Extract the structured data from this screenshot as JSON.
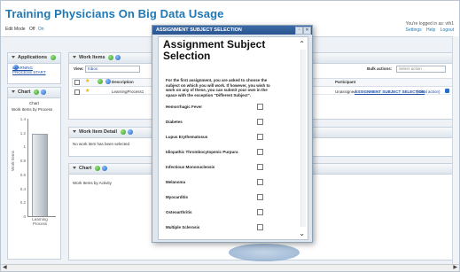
{
  "header": {
    "title": "Training Physicians On Big Data Usage",
    "edit_mode_label": "Edit Mode",
    "edit_off": "Off",
    "edit_on": "On",
    "logged_in": "You're logged in as: vth1",
    "settings": "Settings",
    "help": "Help",
    "logout": "Logout"
  },
  "applications": {
    "title": "Applications",
    "link": "LEARNING PROCESS START"
  },
  "chart_panel": {
    "title": "Chart",
    "subtitle": "Chart",
    "caption": "Work Items by Process",
    "yaxis": "Work Items",
    "xlabel": "Learning Process",
    "ticks": [
      "1.4",
      "1.2",
      "1",
      "0.8",
      "0.6",
      "0.4",
      "0.2",
      "0"
    ]
  },
  "work_items": {
    "title": "Work Items",
    "view_label": "View:",
    "view_value": "Inbox",
    "description_col": "Description",
    "participant_col": "Participant",
    "bulk_actions": "Bulk actions:",
    "select_action": "Select action",
    "row": {
      "description": "LearningProcess1",
      "participant": "Unassigned",
      "task": "ASSIGNMENT SUBJECT SELECTION",
      "extra": "(initial action)"
    }
  },
  "work_item_detail": {
    "title": "Work Item Detail",
    "empty": "No work item has been selected"
  },
  "chart2": {
    "title": "Chart",
    "caption": "Work Items by Activity"
  },
  "modal": {
    "window_title": "ASSIGNMENT SUBJECT SELECTION",
    "heading_line1": "Assignment Subject",
    "heading_line2": "Selection",
    "intro": "For the first assignment, you are asked to choose the subject on which you will work. If however, you wish to work on any of these, you can submit your own in the space with the exception \"Different Subject\".",
    "options": [
      "Hemorrhagic Fever",
      "Diabetes",
      "Lupus Erythematosus",
      "Idiopathic Thrombocytopenic Purpura",
      "Infectious Mononucleosis",
      "Melanoma",
      "Myocarditis",
      "Osteoarthritis",
      "Multiple Sclerosis"
    ]
  }
}
